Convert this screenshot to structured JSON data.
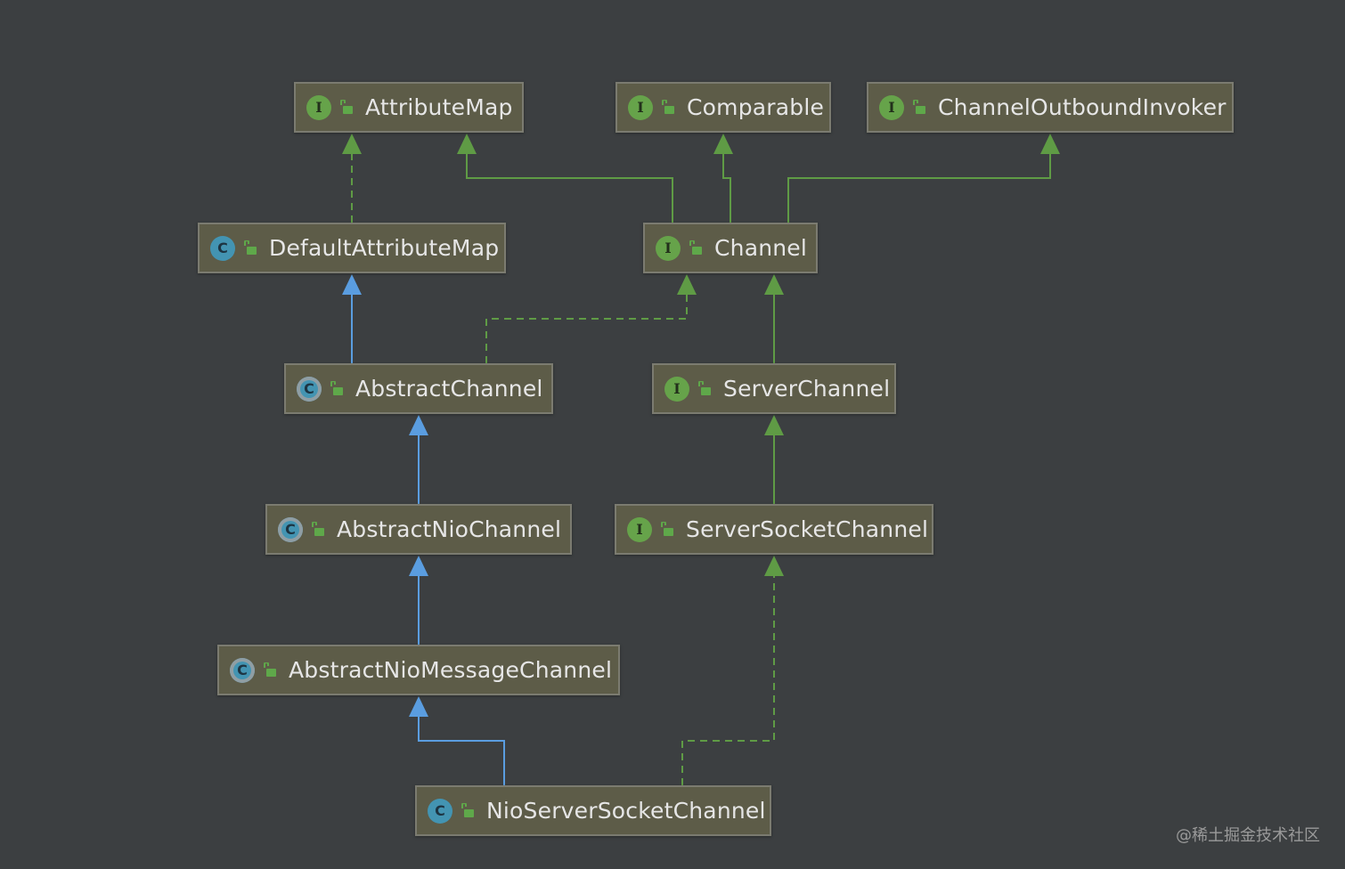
{
  "nodes": {
    "attribute_map": {
      "label": "AttributeMap",
      "kind": "I"
    },
    "comparable": {
      "label": "Comparable",
      "kind": "I"
    },
    "channel_outbound_invoker": {
      "label": "ChannelOutboundInvoker",
      "kind": "I"
    },
    "default_attribute_map": {
      "label": "DefaultAttributeMap",
      "kind": "C"
    },
    "channel": {
      "label": "Channel",
      "kind": "I"
    },
    "abstract_channel": {
      "label": "AbstractChannel",
      "kind": "C"
    },
    "server_channel": {
      "label": "ServerChannel",
      "kind": "I"
    },
    "abstract_nio_channel": {
      "label": "AbstractNioChannel",
      "kind": "C"
    },
    "server_socket_channel": {
      "label": "ServerSocketChannel",
      "kind": "I"
    },
    "abstract_nio_message_channel": {
      "label": "AbstractNioMessageChannel",
      "kind": "C"
    },
    "nio_server_socket_channel": {
      "label": "NioServerSocketChannel",
      "kind": "C"
    }
  },
  "edges": [
    {
      "from": "default_attribute_map",
      "to": "attribute_map",
      "type": "implements"
    },
    {
      "from": "channel",
      "to": "attribute_map",
      "type": "extends-interface"
    },
    {
      "from": "channel",
      "to": "comparable",
      "type": "extends-interface"
    },
    {
      "from": "channel",
      "to": "channel_outbound_invoker",
      "type": "extends-interface"
    },
    {
      "from": "abstract_channel",
      "to": "default_attribute_map",
      "type": "extends"
    },
    {
      "from": "abstract_channel",
      "to": "channel",
      "type": "implements"
    },
    {
      "from": "server_channel",
      "to": "channel",
      "type": "extends-interface"
    },
    {
      "from": "abstract_nio_channel",
      "to": "abstract_channel",
      "type": "extends"
    },
    {
      "from": "server_socket_channel",
      "to": "server_channel",
      "type": "extends-interface"
    },
    {
      "from": "abstract_nio_message_channel",
      "to": "abstract_nio_channel",
      "type": "extends"
    },
    {
      "from": "nio_server_socket_channel",
      "to": "abstract_nio_message_channel",
      "type": "extends"
    },
    {
      "from": "nio_server_socket_channel",
      "to": "server_socket_channel",
      "type": "implements"
    }
  ],
  "colors": {
    "background": "#3c3f41",
    "node_fill": "#5d5c48",
    "node_border": "#7b7b70",
    "interface_edge": "#5f9b45",
    "class_edge": "#5a9de0",
    "text": "#e6e6e6"
  },
  "watermark": "@稀土掘金技术社区"
}
